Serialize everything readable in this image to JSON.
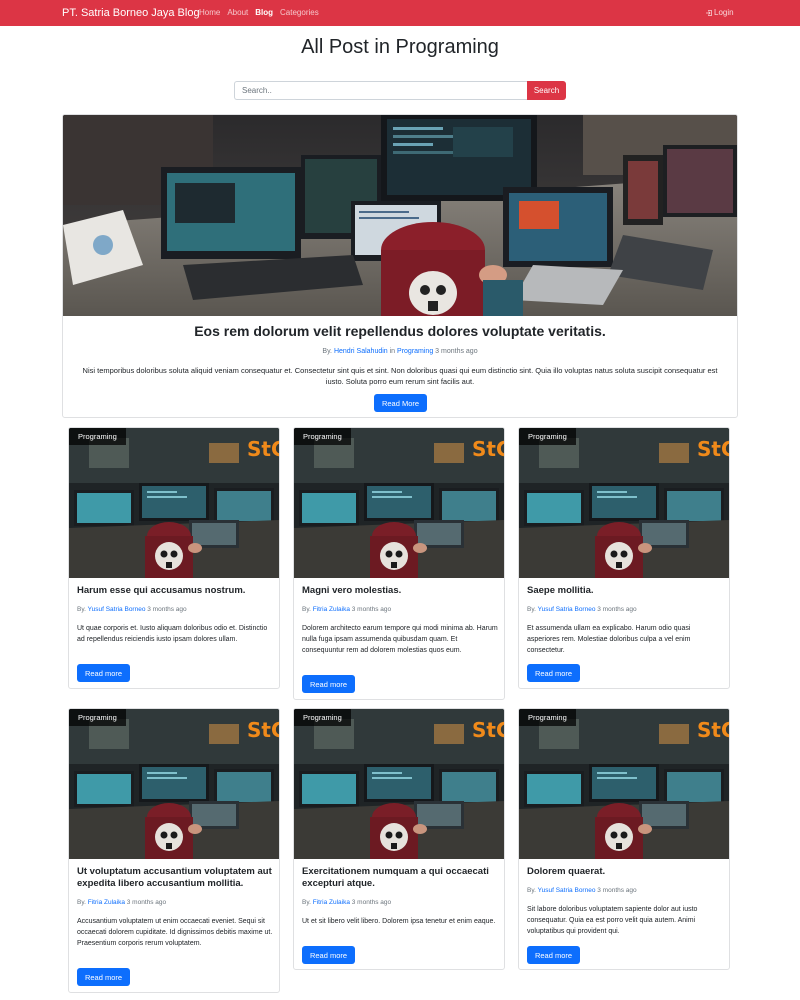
{
  "navbar": {
    "brand": "PT. Satria Borneo Jaya Blog",
    "links": [
      {
        "label": "Home",
        "active": false
      },
      {
        "label": "About",
        "active": false
      },
      {
        "label": "Blog",
        "active": true
      },
      {
        "label": "Categories",
        "active": false
      }
    ],
    "login_label": "Login",
    "login_icon": "login-icon",
    "bg_color": "#dc3545"
  },
  "page": {
    "title": "All Post in Programing"
  },
  "search": {
    "placeholder": "Search..",
    "button_label": "Search"
  },
  "hero": {
    "title": "Eos rem dolorum velit repellendus dolores voluptate veritatis.",
    "meta_by": "By.",
    "author": "Hendri Salahudin",
    "meta_in": "in",
    "category": "Programing",
    "time": "3 months ago",
    "excerpt": "Nisi temporibus doloribus soluta aliquid veniam consequatur et. Consectetur sint quis et sint. Non doloribus quasi qui eum distinctio sint. Quia illo voluptas natus soluta suscipit consequatur est iusto. Soluta porro eum rerum sint facilis aut.",
    "button_label": "Read More"
  },
  "posts": [
    {
      "category": "Programing",
      "title": "Harum esse qui accusamus nostrum.",
      "meta_by": "By.",
      "author": "Yusuf Satria Borneo",
      "time": "3 months ago",
      "excerpt": "Ut quae corporis et. Iusto aliquam doloribus odio et. Distinctio ad repellendus reiciendis iusto ipsam dolores ullam.",
      "button_label": "Read more"
    },
    {
      "category": "Programing",
      "title": "Magni vero molestias.",
      "meta_by": "By.",
      "author": "Fitria Zulaika",
      "time": "3 months ago",
      "excerpt": "Dolorem architecto earum tempore qui modi minima ab. Harum nulla fuga ipsam assumenda quibusdam quam. Et consequuntur rem ad dolorem molestias quos eum.",
      "button_label": "Read more"
    },
    {
      "category": "Programing",
      "title": "Saepe mollitia.",
      "meta_by": "By.",
      "author": "Yusuf Satria Borneo",
      "time": "3 months ago",
      "excerpt": "Et assumenda ullam ea explicabo. Harum odio quasi asperiores rem. Molestiae doloribus culpa a vel enim consectetur.",
      "button_label": "Read more"
    },
    {
      "category": "Programing",
      "title": "Ut voluptatum accusantium voluptatem aut expedita libero accusantium mollitia.",
      "meta_by": "By.",
      "author": "Fitria Zulaika",
      "time": "3 months ago",
      "excerpt": "Accusantium voluptatem ut enim occaecati eveniet. Sequi sit occaecati dolorem cupiditate. Id dignissimos debitis maxime ut. Praesentium corporis rerum voluptatem.",
      "button_label": "Read more"
    },
    {
      "category": "Programing",
      "title": "Exercitationem numquam a qui occaecati excepturi atque.",
      "meta_by": "By.",
      "author": "Fitria Zulaika",
      "time": "3 months ago",
      "excerpt": "Ut et sit libero velit libero. Dolorem ipsa tenetur et enim eaque.",
      "button_label": "Read more"
    },
    {
      "category": "Programing",
      "title": "Dolorem quaerat.",
      "meta_by": "By.",
      "author": "Yusuf Satria Borneo",
      "time": "3 months ago",
      "excerpt": "Sit labore doloribus voluptatem sapiente dolor aut iusto consequatur. Quia ea est porro velit quia autem. Animi voluptatibus qui provident qui.",
      "button_label": "Read more"
    }
  ],
  "colors": {
    "primary": "#0d6efd",
    "danger": "#dc3545",
    "muted": "#6c757d"
  }
}
